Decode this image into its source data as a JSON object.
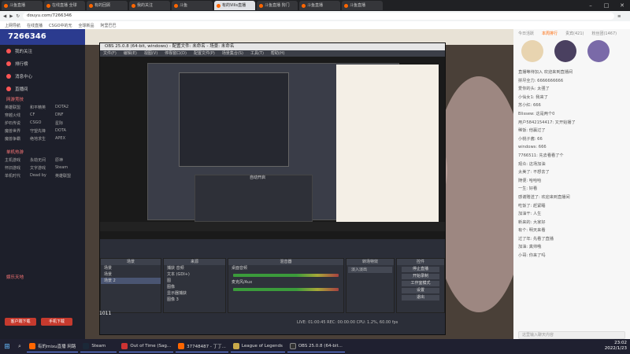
{
  "browser": {
    "tabs": [
      "斗鱼直播",
      "在线直播 全球",
      "有的回顾",
      "我的关注",
      "斗鱼",
      "有的Vilis直播",
      "斗鱼直播 狗门",
      "斗鱼直播",
      "斗鱼直播"
    ],
    "url": "douyu.com/7266346",
    "bookmarks": [
      "上网导航",
      "在线直播",
      "CSGO中的无",
      "全球新品",
      "阿里巴巴"
    ],
    "window_controls": [
      "–",
      "□",
      "✕"
    ]
  },
  "sidebar": {
    "room_id": "7266346",
    "nav": [
      "我的关注",
      "排行榜",
      "消息中心",
      "直播间"
    ],
    "group1": "网游竞技",
    "games": [
      "英雄联盟",
      "和平精英",
      "DOTA2",
      "穿越火线",
      "CF",
      "DNF",
      "炉石传说",
      "CSGO",
      "星际",
      "魔兽世界",
      "守望先锋",
      "DOTA",
      "魔兽争霸",
      "绝地求生",
      "APEX"
    ],
    "group2": "单机热游",
    "games2": [
      "主机游戏",
      "永劫无间",
      "原神",
      "怀旧游戏",
      "文字游戏",
      "Steam",
      "单机时代",
      "Dead by",
      "英雄联盟"
    ],
    "group3": "娱乐天地",
    "buttons": [
      "客户端下载",
      "手机下载"
    ]
  },
  "obs": {
    "title": "OBS 25.0.8 (64-bit, windows) - 配置文件: 未命名 - 场景: 未命名",
    "menu": [
      "文件(F)",
      "编辑(E)",
      "视图(V)",
      "停靠窗口(D)",
      "配置文件(P)",
      "场景集合(S)",
      "工具(T)",
      "帮助(H)"
    ],
    "scenes_header": "场景",
    "scenes": [
      "场景",
      "场景",
      "场景 2"
    ],
    "sources_header": "来源",
    "sources": [
      "捕获 音频",
      "文本 (GDI+)",
      "图",
      "图像",
      "显示器捕获",
      "图像 3"
    ],
    "mixer_header": "混音器",
    "mixer": [
      "桌面音频",
      "麦克风/Aux"
    ],
    "transitions_header": "转场特效",
    "transition": "淡入淡出",
    "controls_header": "控件",
    "controls": [
      "停止直播",
      "开始录制",
      "工作室模式",
      "设置",
      "退出"
    ],
    "status": "LIVE: 01:00:45  REC: 00:00:00  CPU: 1.2%, 60.00 fps",
    "preview_text": "自动开启"
  },
  "chat": {
    "tabs": [
      "今日活跃",
      "本周排行",
      "贵宾(421)",
      "粉丝团(1467)"
    ],
    "lines": [
      "直播等待加入 欢迎来到直播间",
      "拼尽全力: 6666666666",
      "爱你的头: 太强了",
      "小仙女1: 我来了",
      "苏小红: 666",
      "Blissew: 这是两个0",
      "用户5842154417: 又开始播了",
      "稀饭: 他赢过了",
      "小桃子酱: 66",
      "windows: 666",
      "7766511: 先去看看了个",
      "观众: 这场加油",
      "太美了: 不想去了",
      "随便: 哈哈哈",
      "一生: 好看",
      "感谢赠送了: 欢迎来到直播间",
      "吃饭了: 赶紧睡",
      "加油干: 人生",
      "新来的: 大家好",
      "有个: 明天来看",
      "过了年: 先看了直播",
      "加油: 真帅哦",
      "小哥: 你来了吗"
    ],
    "input_placeholder": "这里输入聊天内容"
  },
  "stream": {
    "room_label": "1011"
  },
  "taskbar": {
    "apps": [
      "有的mixu直播 网路",
      "Steam",
      "Out of Time (Sag...",
      "37748487 - 丁丁...",
      "League of Legends",
      "OBS 25.0.8 (64-bit..."
    ],
    "time": "23:02",
    "date": "2022/1/23"
  }
}
